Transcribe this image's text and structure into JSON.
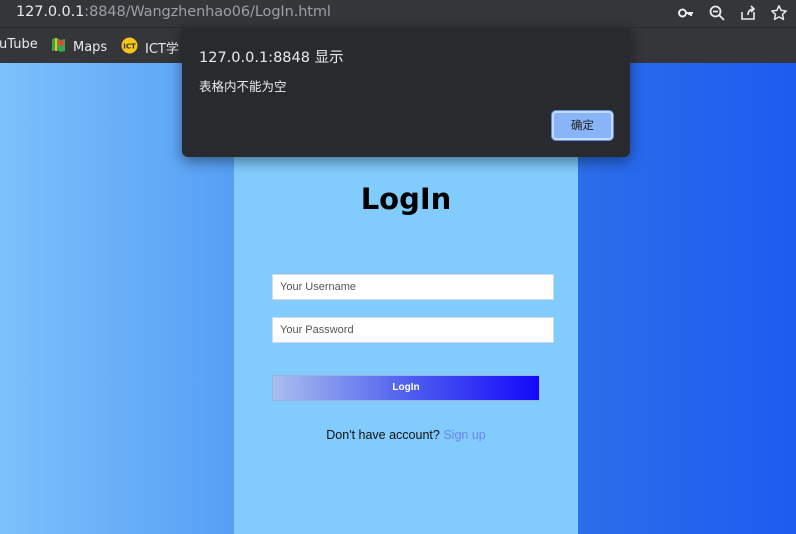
{
  "browser": {
    "url_host": "127.0.0.1",
    "url_rest": ":8848/Wangzhenhao06/LogIn.html",
    "bookmarks": [
      {
        "label": "uTube",
        "icon": "youtube-icon"
      },
      {
        "label": "Maps",
        "icon": "maps-icon"
      },
      {
        "label": "ICT学",
        "icon": "ict-icon"
      }
    ],
    "icons": [
      "key-icon",
      "zoom-out-icon",
      "share-icon",
      "star-icon"
    ]
  },
  "page": {
    "title": "LogIn",
    "username_placeholder": "Your Username",
    "password_placeholder": "Your Password",
    "login_label": "LogIn",
    "signup_prompt": "Don't have account? ",
    "signup_link": "Sign up"
  },
  "dialog": {
    "title": "127.0.0.1:8848 显示",
    "message": "表格内不能为空",
    "ok_label": "确定"
  },
  "colors": {
    "panel": "#81cbfd",
    "dialog_bg": "#292a2d",
    "dialog_button": "#8ab4f8",
    "link": "#6b86ee"
  }
}
